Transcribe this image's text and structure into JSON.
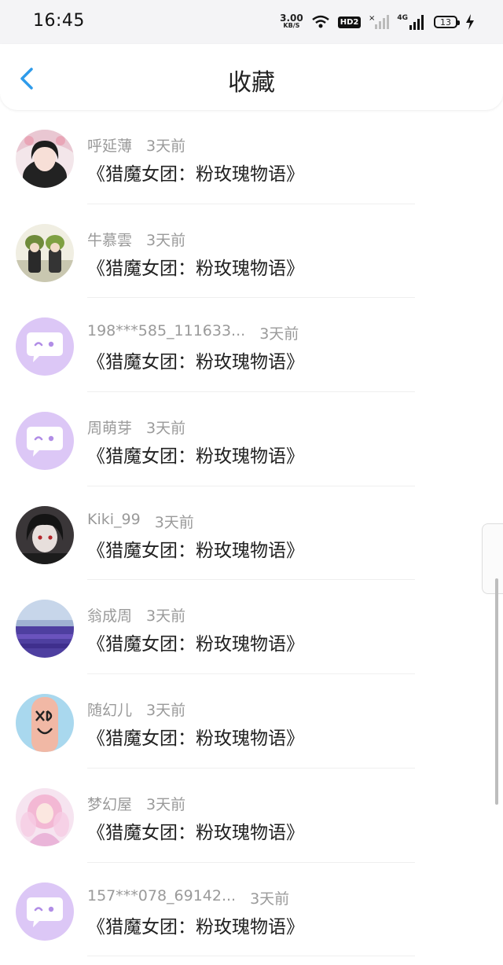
{
  "status_bar": {
    "time": "16:45",
    "net_speed_value": "3.00",
    "net_speed_unit": "KB/S",
    "hd_label": "HD2",
    "signal_label": "4G",
    "battery_level": "13",
    "icons": [
      "wifi-icon",
      "no-signal-icon",
      "signal-bars-icon",
      "battery-icon",
      "charging-bolt-icon"
    ]
  },
  "header": {
    "title": "收藏",
    "back_icon": "chevron-left-icon",
    "accent_color": "#2e9bea"
  },
  "items": [
    {
      "name": "呼延薄",
      "time": "3天前",
      "title": "《猎魔女团：粉玫瑰物语》",
      "avatar": "photo-girl"
    },
    {
      "name": "牛慕雲",
      "time": "3天前",
      "title": "《猎魔女团：粉玫瑰物语》",
      "avatar": "anime-duo"
    },
    {
      "name": "198***585_111633...",
      "time": "3天前",
      "title": "《猎魔女团：粉玫瑰物语》",
      "avatar": "default"
    },
    {
      "name": "周萌芽",
      "time": "3天前",
      "title": "《猎魔女团：粉玫瑰物语》",
      "avatar": "default"
    },
    {
      "name": "Kiki_99",
      "time": "3天前",
      "title": "《猎魔女团：粉玫瑰物语》",
      "avatar": "anime-dark"
    },
    {
      "name": "翁成周",
      "time": "3天前",
      "title": "《猎魔女团：粉玫瑰物语》",
      "avatar": "lavender-field"
    },
    {
      "name": "随幻儿",
      "time": "3天前",
      "title": "《猎魔女团：粉玫瑰物语》",
      "avatar": "finger-xd"
    },
    {
      "name": "梦幻屋",
      "time": "3天前",
      "title": "《猎魔女团：粉玫瑰物语》",
      "avatar": "anime-pink"
    },
    {
      "name": "157***078_69142...",
      "time": "3天前",
      "title": "《猎魔女团：粉玫瑰物语》",
      "avatar": "default"
    }
  ]
}
